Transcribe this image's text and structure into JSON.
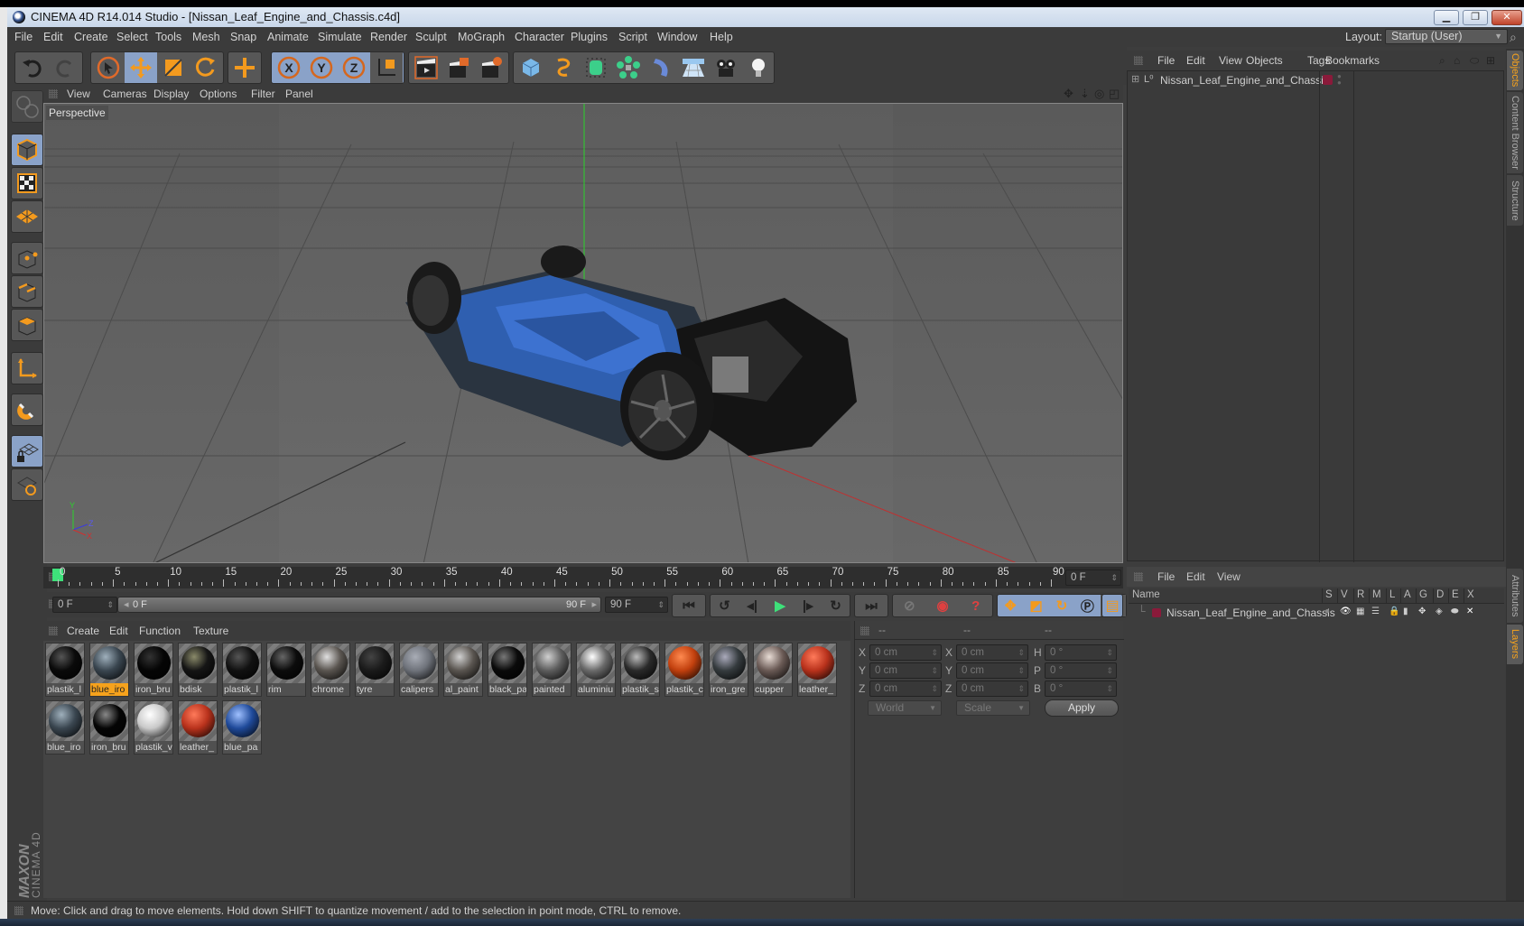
{
  "window": {
    "title": "CINEMA 4D R14.014 Studio - [Nissan_Leaf_Engine_and_Chassis.c4d]",
    "controls": {
      "minimize": "minimize-icon",
      "restore": "restore-icon",
      "close": "close-icon"
    }
  },
  "menubar": {
    "items": [
      "File",
      "Edit",
      "Create",
      "Select",
      "Tools",
      "Mesh",
      "Snap",
      "Animate",
      "Simulate",
      "Render",
      "Sculpt",
      "MoGraph",
      "Character",
      "Plugins",
      "Script",
      "Window",
      "Help"
    ],
    "layout_label": "Layout:",
    "layout_value": "Startup (User)"
  },
  "toolbar": {
    "groups": [
      {
        "name": "history",
        "items": [
          "undo-icon",
          "redo-icon"
        ]
      },
      {
        "name": "tools",
        "items": [
          "live-selection-icon",
          "move-icon",
          "scale-icon",
          "rotate-icon"
        ]
      },
      {
        "name": "recent",
        "items": [
          "recent-tool-icon"
        ]
      },
      {
        "name": "axis",
        "items": [
          "x-axis-lock-icon",
          "y-axis-lock-icon",
          "z-axis-lock-icon",
          "coordinate-system-icon"
        ]
      },
      {
        "name": "render",
        "items": [
          "render-view-icon",
          "render-picture-viewer-icon",
          "render-settings-icon"
        ]
      },
      {
        "name": "objects",
        "items": [
          "cube-icon",
          "spline-icon",
          "nurbs-icon",
          "array-icon",
          "deformer-icon",
          "floor-icon",
          "camera-icon",
          "light-icon"
        ]
      }
    ]
  },
  "left_tools": [
    "make-editable-icon",
    "model-mode-icon",
    "texture-mode-icon",
    "workplane-mode-icon",
    "points-mode-icon",
    "edges-mode-icon",
    "polygons-mode-icon",
    "axis-mode-icon",
    "snap-magnet-icon",
    "locked-workplane-icon",
    "planar-workplane-icon"
  ],
  "viewport": {
    "menu": [
      "View",
      "Cameras",
      "Display",
      "Options",
      "Filter",
      "Panel"
    ],
    "label": "Perspective",
    "nav_icons": [
      "pan-icon",
      "dolly-icon",
      "orbit-icon",
      "maximize-view-icon"
    ],
    "axis_labels": {
      "y": "Y",
      "z": "Z",
      "x": "X"
    }
  },
  "timeline": {
    "ticks": [
      "0",
      "5",
      "10",
      "15",
      "20",
      "25",
      "30",
      "35",
      "40",
      "45",
      "50",
      "55",
      "60",
      "65",
      "70",
      "75",
      "80",
      "85",
      "90"
    ],
    "current_frame": "0 F",
    "start_field": "0 F",
    "range_start": "0 F",
    "range_end": "90 F",
    "end_field": "90 F"
  },
  "playback": {
    "buttons": [
      "go-to-start-icon",
      "previous-key-icon",
      "step-back-icon",
      "play-icon",
      "step-forward-icon",
      "next-key-icon",
      "go-to-end-icon"
    ],
    "record": [
      "motion-record-icon",
      "record-active-icon",
      "autokey-icon"
    ],
    "key_types": [
      "key-position-icon",
      "key-scale-icon",
      "key-rotation-icon",
      "key-parameter-icon",
      "key-point-level-icon"
    ],
    "timeline_button": "timeline-icon"
  },
  "materials": {
    "menu": [
      "Create",
      "Edit",
      "Function",
      "Texture"
    ],
    "items": [
      {
        "name": "plastik_l",
        "color": "#0a0a0a",
        "hl": "#555"
      },
      {
        "name": "blue_iro",
        "color": "#3a4650",
        "hl": "#9fb0bc",
        "selected": true
      },
      {
        "name": "iron_bru",
        "color": "#050505",
        "hl": "#333"
      },
      {
        "name": "bdisk",
        "color": "#151515",
        "hl": "#8a8a6a"
      },
      {
        "name": "plastik_l",
        "color": "#111",
        "hl": "#555"
      },
      {
        "name": "rim",
        "color": "#0c0c0c",
        "hl": "#666"
      },
      {
        "name": "chrome",
        "color": "#5a5550",
        "hl": "#e0e0e0"
      },
      {
        "name": "tyre",
        "color": "#1a1a1a",
        "hl": "#444"
      },
      {
        "name": "calipers",
        "color": "#6f737b",
        "hl": "#a9adb6"
      },
      {
        "name": "al_paint",
        "color": "#5a5550",
        "hl": "#d0d0d0"
      },
      {
        "name": "black_pa",
        "color": "#0a0a0a",
        "hl": "#777"
      },
      {
        "name": "painted",
        "color": "#5d5d5d",
        "hl": "#cfcfcf"
      },
      {
        "name": "aluminiu",
        "color": "#6a6a6a",
        "hl": "#ffffff"
      },
      {
        "name": "plastik_s",
        "color": "#2a2a2a",
        "hl": "#bbb"
      },
      {
        "name": "plastik_c",
        "color": "#c2400e",
        "hl": "#ff8a50"
      },
      {
        "name": "iron_gre",
        "color": "#353b3e",
        "hl": "#aab"
      },
      {
        "name": "cupper",
        "color": "#6a5a55",
        "hl": "#e8dcd5"
      },
      {
        "name": "leather_",
        "color": "#b9321c",
        "hl": "#ff7a5a"
      },
      {
        "name": "blue_iro",
        "color": "#3a4650",
        "hl": "#9fb0bc"
      },
      {
        "name": "iron_bru",
        "color": "#050505",
        "hl": "#888"
      },
      {
        "name": "plastik_v",
        "color": "#c9c9c9",
        "hl": "#ffffff"
      },
      {
        "name": "leather_",
        "color": "#b9321c",
        "hl": "#ff7a5a"
      },
      {
        "name": "blue_pa",
        "color": "#1f4a9a",
        "hl": "#9fc0ff"
      }
    ]
  },
  "coordinates": {
    "headers": [
      "--",
      "--",
      "--"
    ],
    "rows": [
      {
        "pos_label": "X",
        "pos": "0 cm",
        "size_label": "X",
        "size": "0 cm",
        "rot_label": "H",
        "rot": "0 °"
      },
      {
        "pos_label": "Y",
        "pos": "0 cm",
        "size_label": "Y",
        "size": "0 cm",
        "rot_label": "P",
        "rot": "0 °"
      },
      {
        "pos_label": "Z",
        "pos": "0 cm",
        "size_label": "Z",
        "size": "0 cm",
        "rot_label": "B",
        "rot": "0 °"
      }
    ],
    "mode_select": "World",
    "size_select": "Scale",
    "apply_label": "Apply"
  },
  "objects_panel": {
    "menu": [
      "File",
      "Edit",
      "View",
      "Objects",
      "Tags",
      "Bookmarks"
    ],
    "tree": [
      {
        "name": "Nissan_Leaf_Engine_and_Chassis",
        "layer_color": "#8a1a3a"
      }
    ]
  },
  "layers_panel": {
    "menu": [
      "File",
      "Edit",
      "View"
    ],
    "columns": [
      "Name",
      "S",
      "V",
      "R",
      "M",
      "L",
      "A",
      "G",
      "D",
      "E",
      "X"
    ],
    "rows": [
      {
        "name": "Nissan_Leaf_Engine_and_Chassis",
        "color": "#8a1a3a"
      }
    ]
  },
  "side_tabs": {
    "top": [
      {
        "label": "Objects",
        "selected": true
      },
      {
        "label": "Content Browser"
      },
      {
        "label": "Structure"
      }
    ],
    "bottom": [
      {
        "label": "Attributes"
      },
      {
        "label": "Layers",
        "selected": true
      }
    ]
  },
  "branding": {
    "line1": "MAXON",
    "line2": "CINEMA 4D"
  },
  "status": "Move: Click and drag to move elements. Hold down SHIFT to quantize movement / add to the selection in point mode, CTRL to remove.",
  "colors": {
    "accent": "#f6a21c",
    "selected_tool": "#8aa2c8",
    "panel": "#3d3d3d",
    "play": "#3ee07a"
  }
}
